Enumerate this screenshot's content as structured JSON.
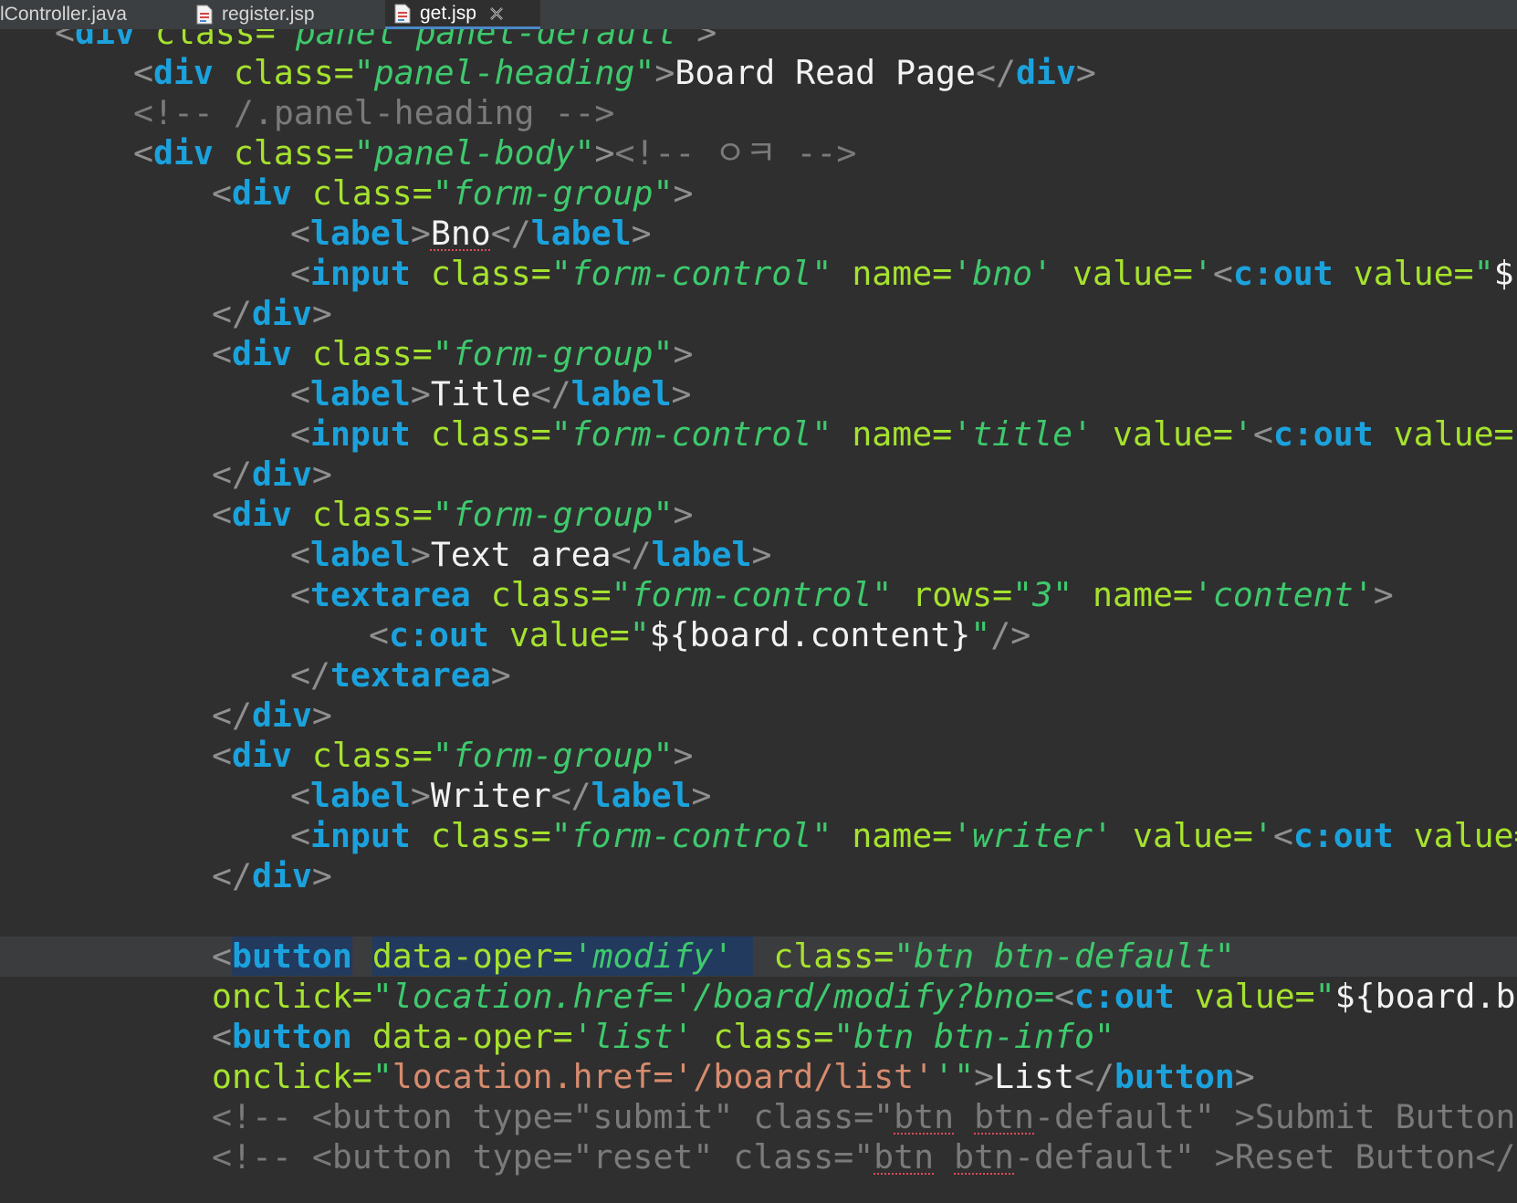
{
  "tabs": [
    {
      "label": "lController.java",
      "icon": "java-file-icon",
      "active": false
    },
    {
      "label": "register.jsp",
      "icon": "jsp-file-icon",
      "active": false
    },
    {
      "label": "get.jsp",
      "icon": "jsp-file-icon",
      "active": true
    }
  ],
  "code": {
    "l01": {
      "p1": "<",
      "p2": "div",
      "p3": " class=",
      "p4": "\"panel panel-default\"",
      "p5": ">"
    },
    "l02": {
      "p1": "<",
      "p2": "div",
      "p3": " class=",
      "p4": "\"panel-heading\"",
      "p5": ">",
      "p6": "Board Read Page",
      "p7": "</",
      "p8": "div",
      "p9": ">"
    },
    "l03": {
      "p1": "<!-- /.panel-heading -->"
    },
    "l04": {
      "p1": "<",
      "p2": "div",
      "p3": " class=",
      "p4": "\"panel-body\"",
      "p5": ">",
      "p6": "<!-- ㅇㅋ -->"
    },
    "l05": {
      "p1": "<",
      "p2": "div",
      "p3": " class=",
      "p4": "\"form-group\"",
      "p5": ">"
    },
    "l06": {
      "p1": "<",
      "p2": "label",
      "p3": ">",
      "p4": "Bno",
      "p5": "</",
      "p6": "label",
      "p7": ">"
    },
    "l07": {
      "p1": "<",
      "p2": "input",
      "p3": " class=",
      "p4": "\"form-control\"",
      "p5": " name=",
      "p6": "'bno'",
      "p7": " value=",
      "p8": "'",
      "p9": "<",
      "p10": "c:out",
      "p11": " value=",
      "p12": "\"",
      "p13": "${"
    },
    "l08": {
      "p1": "</",
      "p2": "div",
      "p3": ">"
    },
    "l09": {
      "p1": "<",
      "p2": "div",
      "p3": " class=",
      "p4": "\"form-group\"",
      "p5": ">"
    },
    "l10": {
      "p1": "<",
      "p2": "label",
      "p3": ">",
      "p4": "Title",
      "p5": "</",
      "p6": "label",
      "p7": ">"
    },
    "l11": {
      "p1": "<",
      "p2": "input",
      "p3": " class=",
      "p4": "\"form-control\"",
      "p5": " name=",
      "p6": "'title'",
      "p7": " value=",
      "p8": "'",
      "p9": "<",
      "p10": "c:out",
      "p11": " value=",
      "p12": "\""
    },
    "l12": {
      "p1": "</",
      "p2": "div",
      "p3": ">"
    },
    "l13": {
      "p1": "<",
      "p2": "div",
      "p3": " class=",
      "p4": "\"form-group\"",
      "p5": ">"
    },
    "l14": {
      "p1": "<",
      "p2": "label",
      "p3": ">",
      "p4": "Text area",
      "p5": "</",
      "p6": "label",
      "p7": ">"
    },
    "l15": {
      "p1": "<",
      "p2": "textarea",
      "p3": " class=",
      "p4": "\"form-control\"",
      "p5": " rows=",
      "p6": "\"3\"",
      "p7": " name=",
      "p8": "'content'",
      "p9": ">"
    },
    "l16": {
      "p1": "<",
      "p2": "c:out",
      "p3": " value=",
      "p4": "\"",
      "p5": "${board.content}",
      "p6": "\"",
      "p7": "/>"
    },
    "l17": {
      "p1": "</",
      "p2": "textarea",
      "p3": ">"
    },
    "l18": {
      "p1": "</",
      "p2": "div",
      "p3": ">"
    },
    "l19": {
      "p1": "<",
      "p2": "div",
      "p3": " class=",
      "p4": "\"form-group\"",
      "p5": ">"
    },
    "l20": {
      "p1": "<",
      "p2": "label",
      "p3": ">",
      "p4": "Writer",
      "p5": "</",
      "p6": "label",
      "p7": ">"
    },
    "l21": {
      "p1": "<",
      "p2": "input",
      "p3": " class=",
      "p4": "\"form-control\"",
      "p5": " name=",
      "p6": "'writer'",
      "p7": " value=",
      "p8": "'",
      "p9": "<",
      "p10": "c:out",
      "p11": " value="
    },
    "l22": {
      "p1": "</",
      "p2": "div",
      "p3": ">"
    },
    "l24": {
      "p1": "<",
      "p2": "button",
      "p3": " ",
      "p4": "data-oper=",
      "p5": "'modify'",
      "p6": " ",
      "p7": " class=",
      "p8": "\"btn btn-default\""
    },
    "l25": {
      "p1": "onclick=",
      "p2": "\"location.href='/board/modify?bno=",
      "p3": "<",
      "p4": "c:out",
      "p5": " value=",
      "p6": "\"",
      "p7": "${board.bn"
    },
    "l26": {
      "p1": "<",
      "p2": "button",
      "p3": " data-oper=",
      "p4": "'list'",
      "p5": " class=",
      "p6": "\"btn btn-info\""
    },
    "l27": {
      "p1": "onclick=",
      "p2": "\"",
      "p3": "location.href='/board/list'",
      "p4": "'\"",
      "p5": ">",
      "p6": "List",
      "p7": "</",
      "p8": "button",
      "p9": ">"
    },
    "l28": {
      "p1": "<!-- <button type=\"submit\" class=\"",
      "p2": "btn",
      "p3": " ",
      "p4": "btn",
      "p5": "-default\" >Submit Button<"
    },
    "l29": {
      "p1": "<!-- <button type=\"reset\" class=\"",
      "p2": "btn",
      "p3": " ",
      "p4": "btn",
      "p5": "-default\" >Reset Button</b"
    }
  },
  "colors": {
    "background": "#2f2f2f",
    "tag": "#1ba2dd",
    "attribute": "#a6e22e",
    "string": "#3ec96d",
    "comment": "#7a7a7a",
    "url_string": "#d78b6e",
    "selection": "#223a5e",
    "current_line": "#3b3c3e"
  }
}
